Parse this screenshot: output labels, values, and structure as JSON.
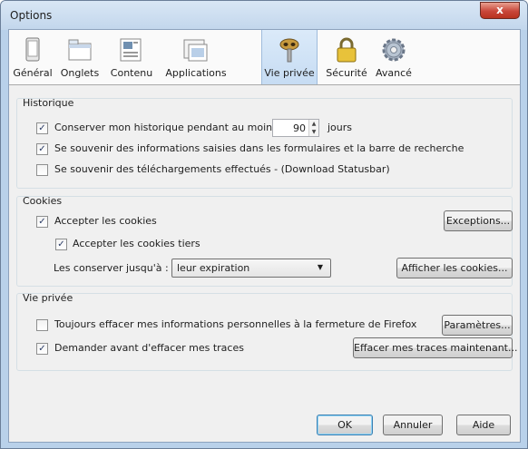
{
  "window": {
    "title": "Options",
    "close_symbol": "x"
  },
  "tabs": [
    {
      "label": "Général",
      "icon": "general-device-icon"
    },
    {
      "label": "Onglets",
      "icon": "tabs-icon"
    },
    {
      "label": "Contenu",
      "icon": "content-icon"
    },
    {
      "label": "Applications",
      "icon": "applications-icon"
    },
    {
      "label": "Vie privée",
      "icon": "privacy-mask-icon",
      "selected": true
    },
    {
      "label": "Sécurité",
      "icon": "lock-icon"
    },
    {
      "label": "Avancé",
      "icon": "gear-icon"
    }
  ],
  "history": {
    "title": "Historique",
    "keep_history": {
      "label": "Conserver mon historique pendant au moins",
      "checked": true,
      "days_value": "90",
      "days_label": "jours"
    },
    "remember_forms": {
      "label": "Se souvenir des informations saisies dans les formulaires et la barre de recherche",
      "checked": true
    },
    "remember_downloads": {
      "label": "Se souvenir des téléchargements effectués - (Download Statusbar)",
      "checked": false
    }
  },
  "cookies": {
    "title": "Cookies",
    "accept": {
      "label": "Accepter les cookies",
      "checked": true
    },
    "accept_third_party": {
      "label": "Accepter les cookies tiers",
      "checked": true
    },
    "keep_until_label": "Les conserver jusqu'à :",
    "keep_until_value": "leur expiration",
    "exceptions_button": "Exceptions...",
    "show_cookies_button": "Afficher les cookies..."
  },
  "privacy": {
    "title": "Vie privée",
    "always_clear": {
      "label": "Toujours effacer mes informations personnelles à la fermeture de Firefox",
      "checked": false
    },
    "ask_before_clear": {
      "label": "Demander avant d'effacer mes traces",
      "checked": true
    },
    "settings_button": "Paramètres...",
    "clear_now_button": "Effacer mes traces maintenant..."
  },
  "footer": {
    "ok": "OK",
    "cancel": "Annuler",
    "help": "Aide"
  },
  "check_mark": "✓",
  "colors": {
    "selected_tab": "#c6dcf3",
    "window_frame": "#b9d1ea",
    "close_button": "#c9473a",
    "dialog_bg": "#f0f0f0"
  }
}
